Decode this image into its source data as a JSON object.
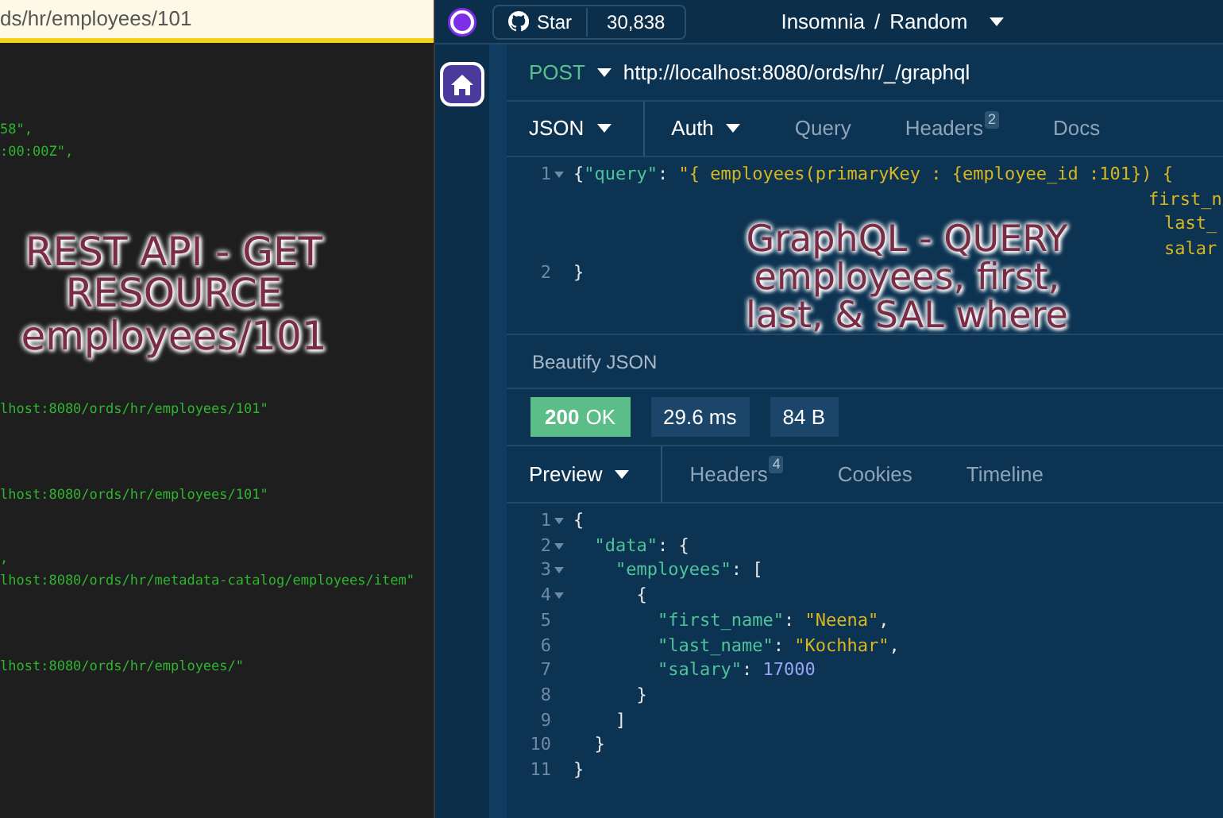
{
  "browser": {
    "address": "ds/hr/employees/101",
    "code_lines": [
      {
        "text": "58\","
      },
      {
        "text": ":00:00Z\","
      },
      {
        "text": "lhost:8080/ords/hr/employees/101\""
      },
      {
        "text": "lhost:8080/ords/hr/employees/101\""
      },
      {
        "text": ","
      },
      {
        "text": "lhost:8080/ords/hr/metadata-catalog/employees/item\""
      },
      {
        "text": "lhost:8080/ords/hr/employees/\""
      }
    ],
    "annotation": [
      "REST API - GET",
      "RESOURCE",
      "employees/101"
    ]
  },
  "insomnia": {
    "star_label": "Star",
    "star_count": "30,838",
    "breadcrumb": [
      "Insomnia",
      "/",
      "Random"
    ],
    "request": {
      "method": "POST",
      "url": "http://localhost:8080/ords/hr/_/graphql",
      "tabs": [
        {
          "label": "JSON",
          "selected": true,
          "dropdown": true
        },
        {
          "label": "Auth",
          "selected": false,
          "dropdown": true
        },
        {
          "label": "Query",
          "selected": false
        },
        {
          "label": "Headers",
          "badge": "2",
          "selected": false
        },
        {
          "label": "Docs",
          "selected": false
        }
      ],
      "body_lines": [
        {
          "number": "1",
          "fold": true,
          "segments": [
            {
              "kind": "punct",
              "text": "{"
            },
            {
              "kind": "key",
              "text": "\"query\""
            },
            {
              "kind": "punct",
              "text": ": "
            },
            {
              "kind": "string",
              "text": "\"{ employees(primaryKey : {employee_id :101}) {"
            }
          ]
        },
        {
          "kind": "wrap",
          "segments": [
            {
              "kind": "string",
              "text": "first_n"
            }
          ]
        },
        {
          "kind": "wrap",
          "segments": [
            {
              "kind": "string",
              "text": "last_"
            }
          ]
        },
        {
          "kind": "wrap",
          "segments": [
            {
              "kind": "string",
              "text": "salar"
            }
          ]
        },
        {
          "number": "2",
          "fold": false,
          "segments": [
            {
              "kind": "punct",
              "text": "}"
            }
          ]
        }
      ],
      "beautify": "Beautify JSON"
    },
    "annotation": [
      "GraphQL - QUERY",
      "employees, first,",
      "last, & SAL where"
    ],
    "response": {
      "status_code": "200",
      "status_text": "OK",
      "time": "29.6 ms",
      "size": "84 B",
      "tabs": [
        {
          "label": "Preview",
          "selected": true,
          "dropdown": true
        },
        {
          "label": "Headers",
          "badge": "4",
          "selected": false
        },
        {
          "label": "Cookies",
          "selected": false
        },
        {
          "label": "Timeline",
          "selected": false
        }
      ],
      "lines": [
        {
          "number": "1",
          "fold": true,
          "segments": [
            {
              "kind": "punct",
              "text": "{"
            }
          ]
        },
        {
          "number": "2",
          "fold": true,
          "segments": [
            {
              "kind": "key",
              "text": "  \"data\""
            },
            {
              "kind": "punct",
              "text": ": {"
            }
          ]
        },
        {
          "number": "3",
          "fold": true,
          "segments": [
            {
              "kind": "key",
              "text": "    \"employees\""
            },
            {
              "kind": "punct",
              "text": ": ["
            }
          ]
        },
        {
          "number": "4",
          "fold": true,
          "segments": [
            {
              "kind": "punct",
              "text": "      {"
            }
          ]
        },
        {
          "number": "5",
          "fold": false,
          "segments": [
            {
              "kind": "key",
              "text": "        \"first_name\""
            },
            {
              "kind": "punct",
              "text": ": "
            },
            {
              "kind": "string",
              "text": "\"Neena\""
            },
            {
              "kind": "punct",
              "text": ","
            }
          ]
        },
        {
          "number": "6",
          "fold": false,
          "segments": [
            {
              "kind": "key",
              "text": "        \"last_name\""
            },
            {
              "kind": "punct",
              "text": ": "
            },
            {
              "kind": "string",
              "text": "\"Kochhar\""
            },
            {
              "kind": "punct",
              "text": ","
            }
          ]
        },
        {
          "number": "7",
          "fold": false,
          "segments": [
            {
              "kind": "key",
              "text": "        \"salary\""
            },
            {
              "kind": "punct",
              "text": ": "
            },
            {
              "kind": "number",
              "text": "17000"
            }
          ]
        },
        {
          "number": "8",
          "fold": false,
          "segments": [
            {
              "kind": "punct",
              "text": "      }"
            }
          ]
        },
        {
          "number": "9",
          "fold": false,
          "segments": [
            {
              "kind": "punct",
              "text": "    ]"
            }
          ]
        },
        {
          "number": "10",
          "fold": false,
          "segments": [
            {
              "kind": "punct",
              "text": "  }"
            }
          ]
        },
        {
          "number": "11",
          "fold": false,
          "segments": [
            {
              "kind": "punct",
              "text": "}"
            }
          ]
        }
      ]
    }
  }
}
